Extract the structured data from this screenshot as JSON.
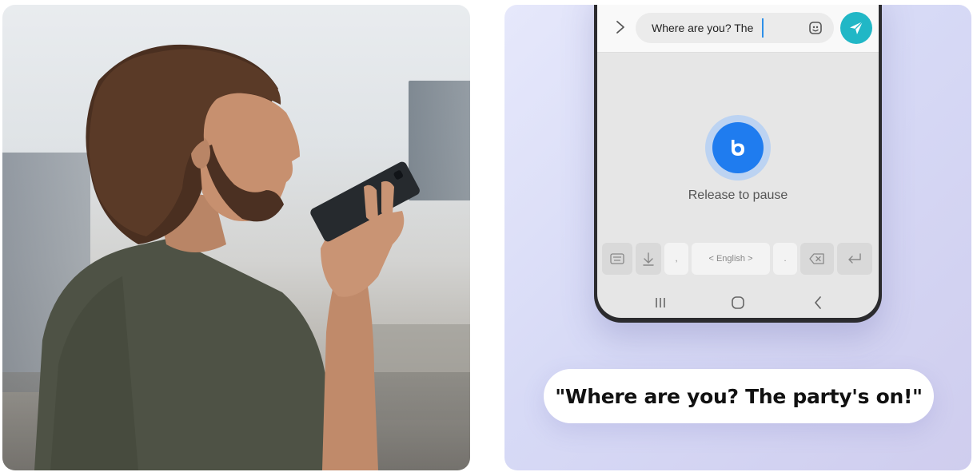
{
  "photo": {
    "description_icon": "person-speaking-into-phone"
  },
  "compose": {
    "field_value": "Where are you? The",
    "accent_color": "#21b7c6",
    "caret_color": "#2d8fe8"
  },
  "voice": {
    "status_text": "Release to pause",
    "button_color": "#1f7cef"
  },
  "keyboard": {
    "comma": ",",
    "language_label": "< English >",
    "period": "."
  },
  "quote": {
    "text": "\"Where are you? The party's on!\""
  }
}
